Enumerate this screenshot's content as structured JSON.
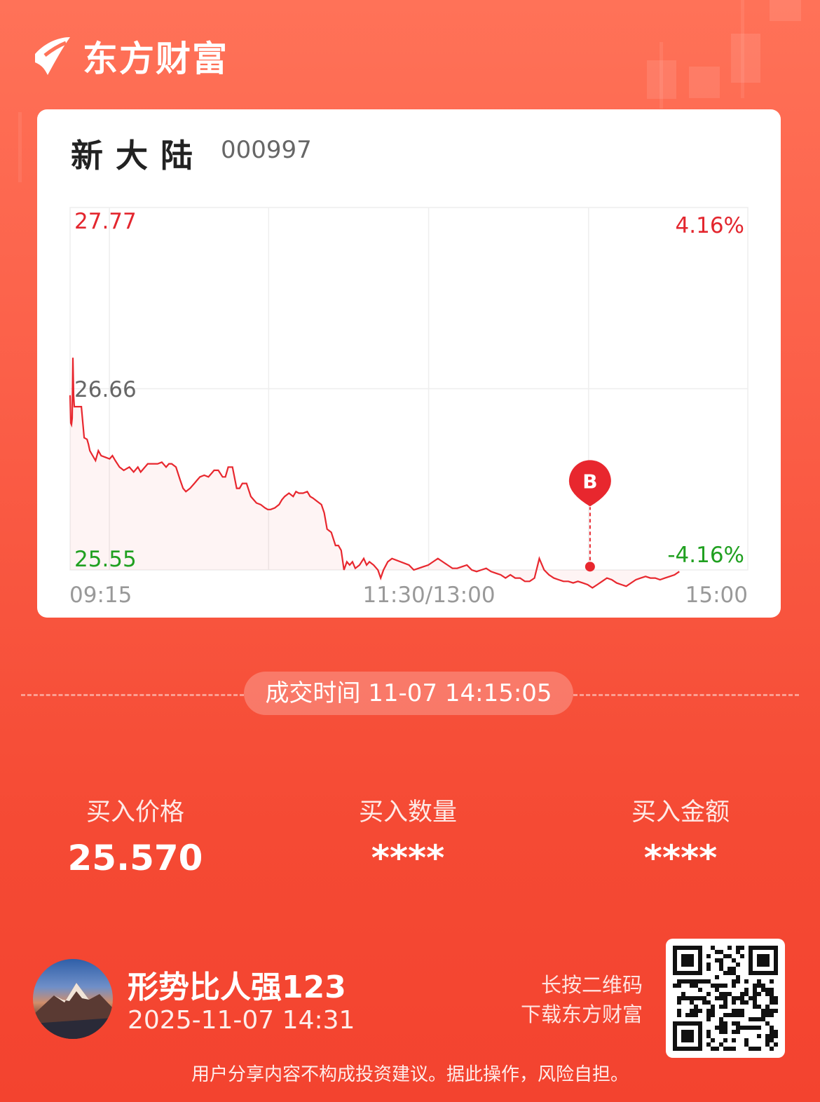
{
  "brand": {
    "name": "东方财富"
  },
  "stock": {
    "name": "新大陆",
    "code": "000997"
  },
  "chart_data": {
    "type": "line",
    "title": "",
    "y_left_ticks": [
      "27.77",
      "26.66",
      "25.55"
    ],
    "y_right_ticks": [
      "4.16%",
      "-4.16%"
    ],
    "x_ticks": [
      "09:15",
      "11:30/13:00",
      "15:00"
    ],
    "ylim": [
      25.55,
      27.77
    ],
    "grid": true,
    "x_minutes": [
      0,
      0.5,
      1,
      1.5,
      2,
      2.5,
      3,
      4,
      5,
      8,
      10,
      12,
      13,
      14,
      16,
      18,
      20,
      22,
      25,
      28,
      30,
      32,
      35,
      38,
      40,
      42,
      45,
      48,
      50,
      52,
      55,
      58,
      60,
      62,
      65,
      68,
      70,
      72,
      75,
      78,
      80,
      82,
      85,
      88,
      90,
      92,
      95,
      98,
      100,
      102,
      105,
      108,
      110,
      112,
      115,
      118,
      120,
      122,
      125,
      128,
      130,
      132,
      135,
      138,
      140,
      142,
      145,
      148,
      150,
      152,
      155,
      158,
      160,
      162,
      165,
      168,
      170,
      172,
      175,
      178,
      180,
      182,
      185,
      188,
      190,
      192,
      194,
      196,
      198,
      200,
      202,
      205,
      208,
      210,
      212,
      215,
      218,
      220,
      222,
      225,
      228
    ],
    "price": [
      26.62,
      26.45,
      26.44,
      26.48,
      26.85,
      26.62,
      26.55,
      26.55,
      26.55,
      26.55,
      26.36,
      26.35,
      26.32,
      26.28,
      26.25,
      26.22,
      26.28,
      26.25,
      26.24,
      26.23,
      26.25,
      26.22,
      26.18,
      26.16,
      26.17,
      26.18,
      26.15,
      26.18,
      26.15,
      26.17,
      26.2,
      26.2,
      26.2,
      26.2,
      26.21,
      26.18,
      26.2,
      26.2,
      26.18,
      26.1,
      26.05,
      26.03,
      26.05,
      26.08,
      26.1,
      26.12,
      26.13,
      26.12,
      26.14,
      26.16,
      26.16,
      26.12,
      26.12,
      26.18,
      26.18,
      26.05,
      26.05,
      26.08,
      26.08,
      26.0,
      25.98,
      25.96,
      25.95,
      25.93,
      25.92,
      25.92,
      25.93,
      25.95,
      25.98,
      26.0,
      26.02,
      26.0,
      26.03,
      26.02,
      26.02,
      26.03,
      26.0,
      25.99,
      25.97,
      25.95,
      25.9,
      25.8,
      25.78,
      25.7,
      25.7,
      25.67,
      25.55,
      25.6,
      25.58,
      25.6,
      25.56,
      25.58,
      25.62,
      25.58,
      25.6,
      25.58,
      25.55,
      25.5,
      25.55,
      25.6,
      25.62
    ],
    "afternoon_minutes": [
      0,
      2,
      4,
      6,
      8,
      10,
      12,
      14,
      16,
      18,
      20,
      22,
      24,
      26,
      28,
      30,
      32,
      34,
      36,
      38,
      40,
      42,
      44,
      46,
      48,
      50,
      52,
      54,
      56,
      58,
      60,
      62,
      64,
      66,
      68,
      70,
      72,
      74,
      76,
      78,
      80,
      82,
      84,
      86,
      88,
      90,
      92,
      94,
      96,
      98,
      100,
      102,
      104,
      106,
      108,
      110,
      112
    ],
    "afternoon_price": [
      25.58,
      25.55,
      25.56,
      25.57,
      25.58,
      25.6,
      25.62,
      25.6,
      25.58,
      25.56,
      25.56,
      25.57,
      25.58,
      25.55,
      25.54,
      25.55,
      25.56,
      25.54,
      25.53,
      25.52,
      25.5,
      25.52,
      25.5,
      25.5,
      25.48,
      25.48,
      25.5,
      25.62,
      25.55,
      25.52,
      25.5,
      25.49,
      25.48,
      25.48,
      25.47,
      25.48,
      25.47,
      25.46,
      25.44,
      25.46,
      25.48,
      25.5,
      25.49,
      25.47,
      25.46,
      25.45,
      25.47,
      25.49,
      25.5,
      25.51,
      25.5,
      25.5,
      25.49,
      25.5,
      25.51,
      25.52,
      25.54
    ],
    "buy_marker": {
      "label": "B",
      "time": "14:15",
      "price": 25.57
    },
    "colors": {
      "line": "#e8272e",
      "up": "#e3262e",
      "down": "#20a020",
      "neutral": "#666666"
    }
  },
  "trade": {
    "time_text": "成交时间 11-07 14:15:05"
  },
  "stats": [
    {
      "label": "买入价格",
      "value": "25.570"
    },
    {
      "label": "买入数量",
      "value": "****"
    },
    {
      "label": "买入金额",
      "value": "****"
    }
  ],
  "user": {
    "name": "形势比人强123",
    "time": "2025-11-07 14:31"
  },
  "qr": {
    "hint_line1": "长按二维码",
    "hint_line2": "下载东方财富"
  },
  "disclaimer": "用户分享内容不构成投资建议。据此操作，风险自担。"
}
